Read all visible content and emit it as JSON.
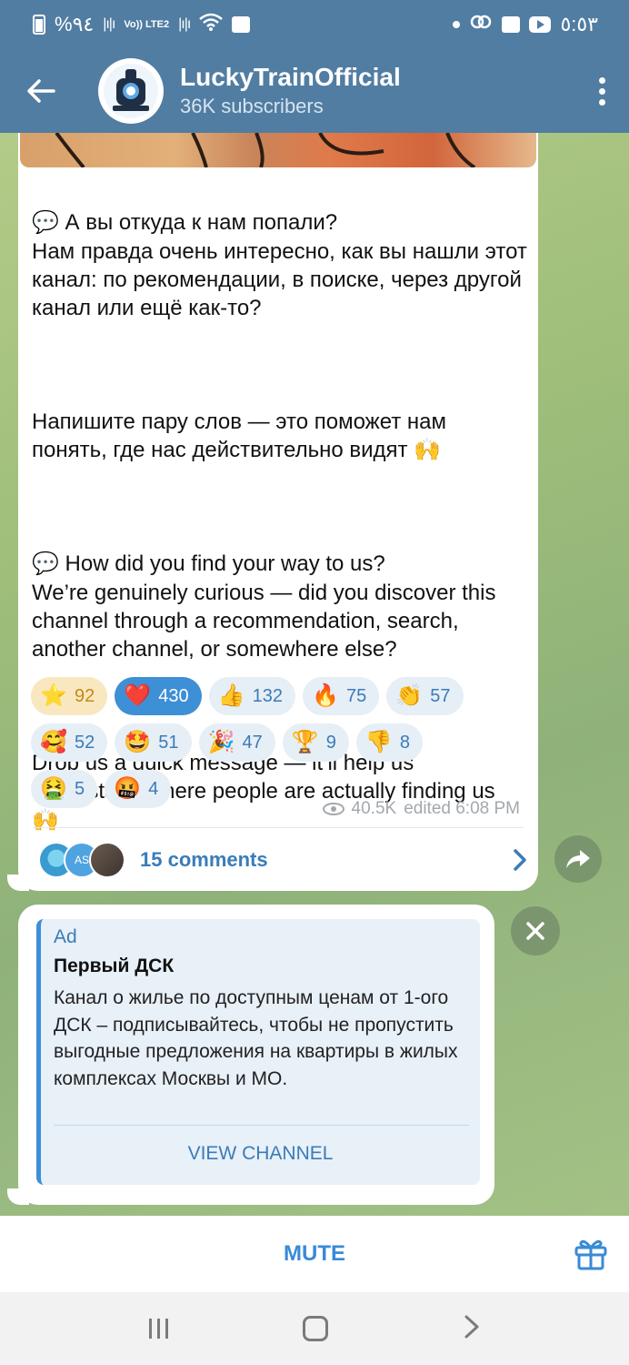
{
  "status_bar": {
    "left_text": "%٩٤",
    "lte_text": "Vo)) LTE2",
    "time": "٥:٥٣"
  },
  "header": {
    "channel_name": "LuckyTrainOfficial",
    "subscribers": "36K subscribers"
  },
  "post": {
    "text_ru_1": "💬 А вы откуда к нам попали?\nНам правда очень интересно, как вы нашли этот канал: по рекомендации, в поиске, через другой канал или ещё как-то?",
    "text_ru_2": "Напишите пару слов — это поможет нам понять, где нас действительно видят 🙌",
    "text_en_1": "💬 How did you find your way to us?\nWe’re genuinely curious — did you discover this channel through a recommendation, search, another channel, or somewhere else?",
    "text_en_2": "Drop us a quick message — it’ll help us understand where people are actually finding us 🙌",
    "reactions": [
      {
        "emoji": "⭐",
        "count": "92"
      },
      {
        "emoji": "❤️",
        "count": "430"
      },
      {
        "emoji": "👍",
        "count": "132"
      },
      {
        "emoji": "🔥",
        "count": "75"
      },
      {
        "emoji": "👏",
        "count": "57"
      },
      {
        "emoji": "🥰",
        "count": "52"
      },
      {
        "emoji": "🤩",
        "count": "51"
      },
      {
        "emoji": "🎉",
        "count": "47"
      },
      {
        "emoji": "🏆",
        "count": "9"
      },
      {
        "emoji": "👎",
        "count": "8"
      },
      {
        "emoji": "🤮",
        "count": "5"
      },
      {
        "emoji": "🤬",
        "count": "4"
      }
    ],
    "views": "40.5K",
    "edited": "edited 6:08 PM",
    "comment_avatar_initials": "AS",
    "comments_label": "15 comments"
  },
  "ad": {
    "label": "Ad",
    "title": "Первый ДСК",
    "text": "Канал о жилье по доступным ценам от 1-ого ДСК – подписывайтесь, чтобы не пропустить выгодные предложения на квартиры в жилых комплексах Москвы и МО.",
    "action": "VIEW CHANNEL"
  },
  "bottom": {
    "mute_label": "MUTE"
  },
  "colors": {
    "header": "#517da2",
    "accent": "#3a8ad6",
    "active_reaction": "#3d8fd6",
    "star_reaction": "#f9e7bf"
  },
  "icons": [
    "back-arrow-icon",
    "more-vert-icon",
    "eye-icon",
    "chevron-right-icon",
    "share-icon",
    "close-icon",
    "gift-icon"
  ]
}
